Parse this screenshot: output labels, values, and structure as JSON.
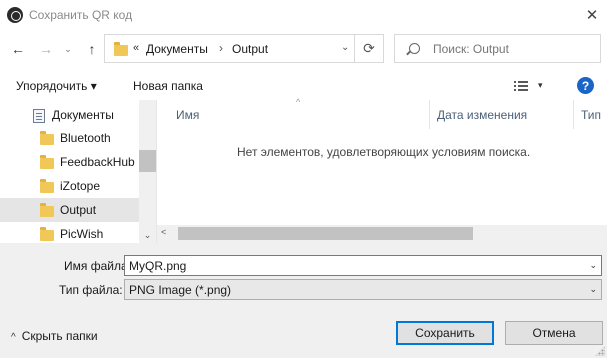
{
  "window": {
    "title": "Сохранить QR код",
    "close_glyph": "✕"
  },
  "navigation": {
    "back": "←",
    "forward": "→",
    "recent": "⌄",
    "up": "↑",
    "address": {
      "overflow": "«",
      "crumbs": [
        "Документы",
        "Output"
      ],
      "separator": "›",
      "dropdown": "⌄",
      "refresh": "⟳"
    },
    "search_placeholder": "Поиск: Output"
  },
  "toolbar": {
    "organize": "Упорядочить ▾",
    "new_folder": "Новая папка",
    "view_dropdown": "▾",
    "help": "?"
  },
  "tree": {
    "items": [
      {
        "label": "Документы",
        "icon": "document-icon"
      },
      {
        "label": "Bluetooth",
        "icon": "folder-icon"
      },
      {
        "label": "FeedbackHub",
        "icon": "folder-icon"
      },
      {
        "label": "iZotope",
        "icon": "folder-icon"
      },
      {
        "label": "Output",
        "icon": "folder-icon",
        "selected": true
      },
      {
        "label": "PicWish",
        "icon": "folder-icon"
      }
    ],
    "scroll_down": "⌄"
  },
  "columns": {
    "name": "Имя",
    "modified": "Дата изменения",
    "type": "Тип",
    "sort_indicator": "^"
  },
  "empty_message": "Нет элементов, удовлетворяющих условиям поиска.",
  "hscroll_left": "<",
  "form": {
    "filename_label": "Имя файла:",
    "filename_value": "MyQR.png",
    "filetype_label": "Тип файла:",
    "filetype_value": "PNG Image (*.png)",
    "dropdown": "⌄"
  },
  "footer": {
    "hide_folders": "Скрыть папки",
    "hide_chevron": "^",
    "save": "Сохранить",
    "cancel": "Отмена"
  },
  "colors": {
    "help_blue": "#1a66c8",
    "folder_yellow": "#f1c857",
    "primary_border": "#0078d7"
  }
}
